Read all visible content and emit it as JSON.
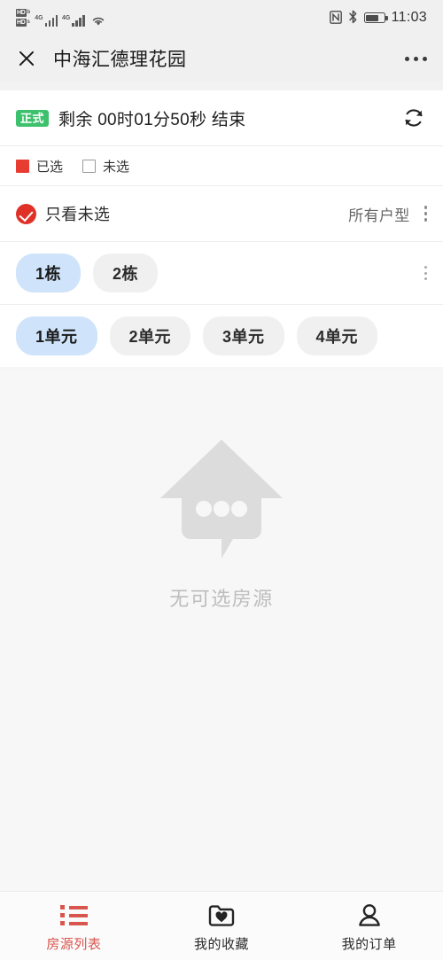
{
  "statusbar": {
    "hd_primary_label": "HD",
    "hd_primary_sub": "b",
    "hd_secondary_label": "HD",
    "hd_secondary_sub": "s",
    "signal1_network": "4G",
    "signal2_network": "4G",
    "wifi_icon": "wifi-icon",
    "nfc_glyph": "N",
    "bluetooth_glyph": "✶",
    "battery_icon": "battery-icon",
    "clock": "11:03"
  },
  "appbar": {
    "close_icon": "close-icon",
    "title": "中海汇德理花园",
    "more_icon": "more-horizontal-icon"
  },
  "countdown": {
    "badge": "正式",
    "text": "剩余 00时01分50秒 结束",
    "refresh_icon": "refresh-icon"
  },
  "legend": {
    "items": [
      {
        "label": "已选",
        "state": "selected",
        "color": "#e83c32"
      },
      {
        "label": "未选",
        "state": "unselected",
        "color": "#ffffff"
      }
    ]
  },
  "filter": {
    "only_unselected_label": "只看未选",
    "only_unselected_checked": true,
    "check_icon": "check-circle-icon",
    "house_type_label": "所有户型",
    "more_icon": "more-vertical-icon"
  },
  "buildings": {
    "items": [
      {
        "label": "1栋",
        "selected": true
      },
      {
        "label": "2栋",
        "selected": false
      }
    ],
    "more_icon": "more-vertical-icon"
  },
  "units": {
    "items": [
      {
        "label": "1单元",
        "selected": true
      },
      {
        "label": "2单元",
        "selected": false
      },
      {
        "label": "3单元",
        "selected": false
      },
      {
        "label": "4单元",
        "selected": false
      }
    ]
  },
  "empty_state": {
    "icon": "house-chat-empty-icon",
    "text": "无可选房源"
  },
  "bottomnav": {
    "items": [
      {
        "label": "房源列表",
        "icon": "list-icon",
        "active": true
      },
      {
        "label": "我的收藏",
        "icon": "folder-heart-icon",
        "active": false
      },
      {
        "label": "我的订单",
        "icon": "person-icon",
        "active": false
      }
    ]
  },
  "colors": {
    "accent_red": "#d9564e",
    "badge_green": "#3dc16d",
    "pill_selected": "#cfe4fb",
    "pill_default": "#f0f0f0",
    "page_bg": "#f7f7f7"
  }
}
